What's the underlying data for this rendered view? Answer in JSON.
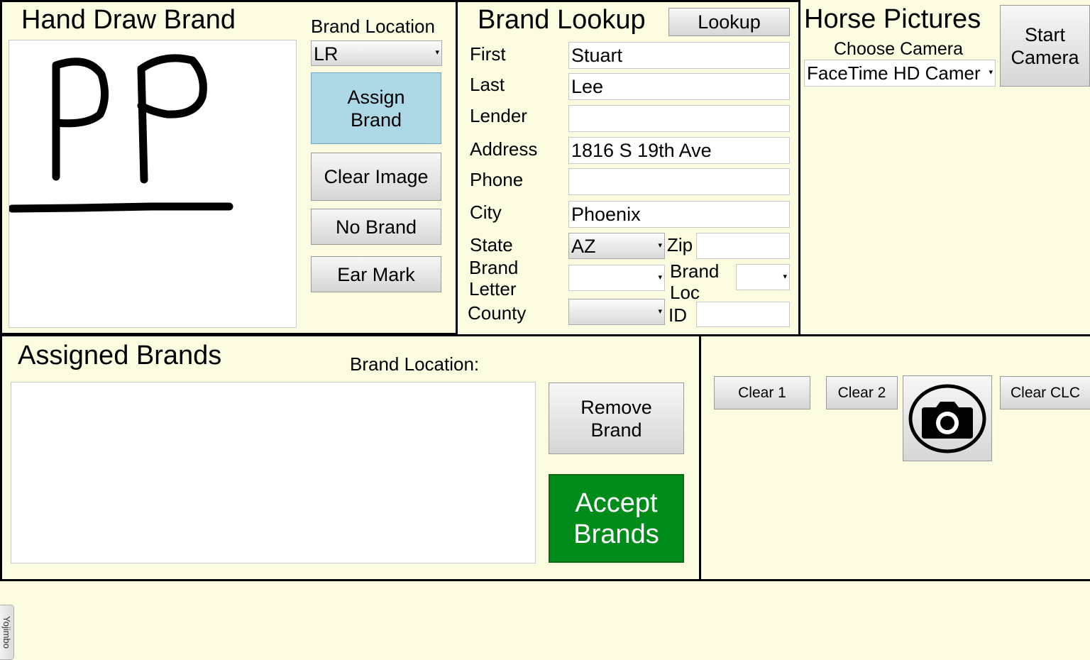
{
  "hand_draw": {
    "title": "Hand Draw Brand",
    "brand_location_label": "Brand Location",
    "brand_location_value": "LR",
    "assign_label": "Assign Brand",
    "clear_image_label": "Clear Image",
    "no_brand_label": "No Brand",
    "ear_mark_label": "Ear Mark"
  },
  "lookup": {
    "title": "Brand Lookup",
    "lookup_button": "Lookup",
    "first_label": "First",
    "first_value": "Stuart",
    "last_label": "Last",
    "last_value": "Lee",
    "lender_label": "Lender",
    "lender_value": "",
    "address_label": "Address",
    "address_value": "1816 S 19th Ave",
    "phone_label": "Phone",
    "phone_value": "",
    "city_label": "City",
    "city_value": "Phoenix",
    "state_label": "State",
    "state_value": "AZ",
    "zip_label": "Zip",
    "zip_value": "",
    "brand_letter_label_1": "Brand",
    "brand_letter_label_2": "Letter",
    "brand_letter_value": "",
    "brand_loc_label_1": "Brand",
    "brand_loc_label_2": "Loc",
    "brand_loc_value": "",
    "county_label": "County",
    "county_value": "",
    "id_label": "ID",
    "id_value": ""
  },
  "horse": {
    "title": "Horse Pictures",
    "choose_camera_label": "Choose Camera",
    "camera_value": "FaceTime HD Camer",
    "start_camera_label": "Start Camera",
    "clear1_label": "Clear 1",
    "clear2_label": "Clear 2",
    "clear_clc_label": "Clear CLC"
  },
  "assigned": {
    "title": "Assigned Brands",
    "brand_location_label": "Brand Location:",
    "remove_label": "Remove Brand",
    "accept_label": "Accept Brands"
  },
  "side_tab": {
    "label": "Yojimbo"
  },
  "colors": {
    "background": "#fdfbe0",
    "assign_button": "#add8e6",
    "accept_button": "#008c1a"
  }
}
